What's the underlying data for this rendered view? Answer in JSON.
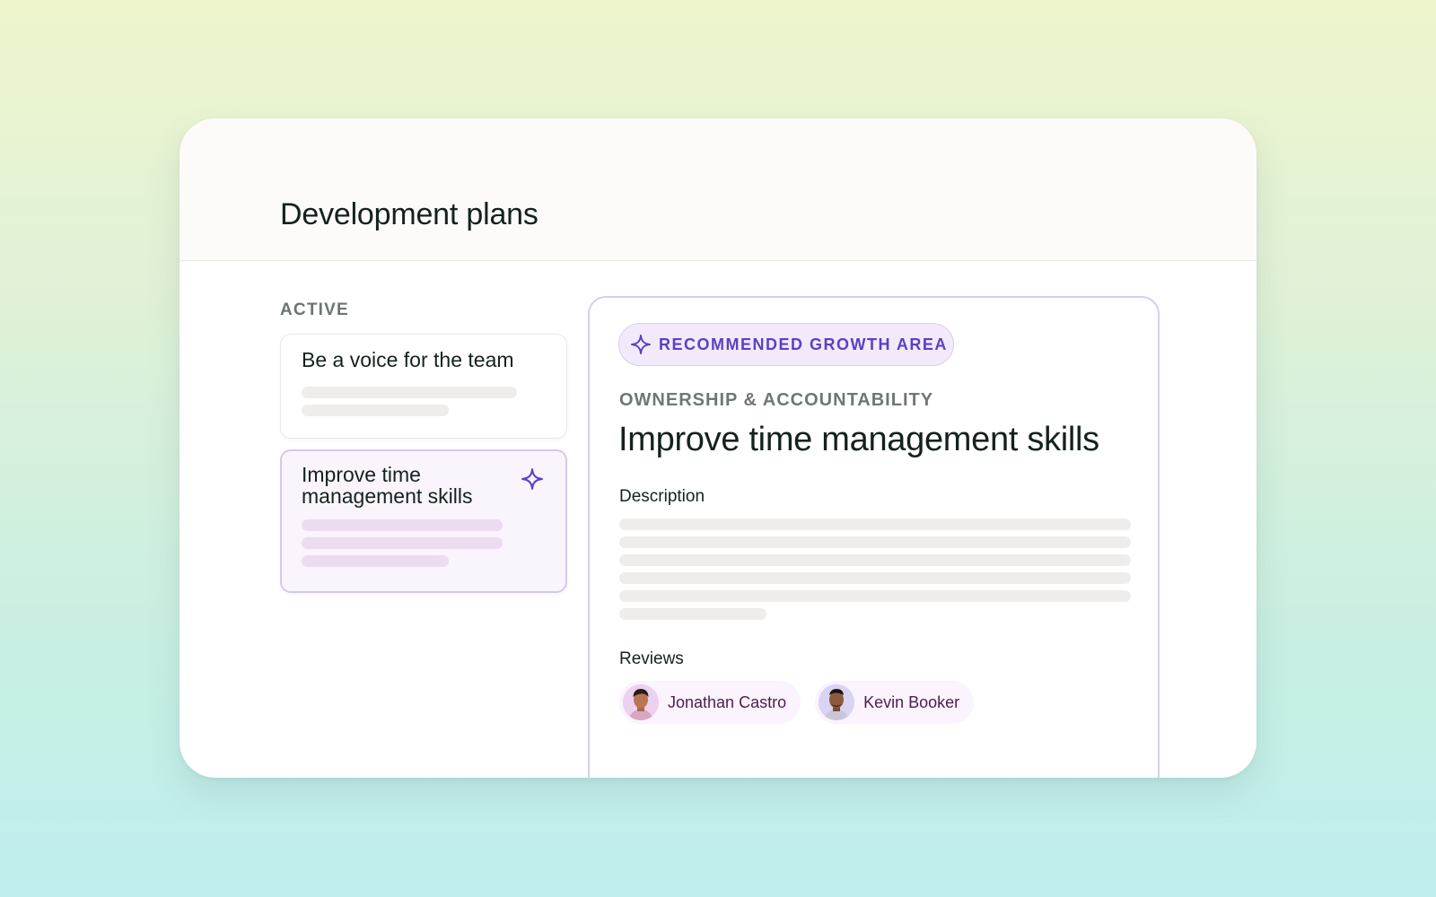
{
  "header": {
    "title": "Development plans"
  },
  "active_section": {
    "label": "ACTIVE",
    "plans": [
      {
        "title": "Be a voice for the team",
        "icon": null
      },
      {
        "title": "Improve time management skills",
        "icon": "sparkle-icon"
      }
    ]
  },
  "detail": {
    "badge": {
      "icon": "sparkle-icon",
      "label": "RECOMMENDED GROWTH AREA"
    },
    "category": "OWNERSHIP & ACCOUNTABILITY",
    "title": "Improve time management skills",
    "description_label": "Description",
    "reviews_label": "Reviews",
    "reviewers": [
      {
        "name": "Jonathan Castro",
        "avatar": "avatar-photo"
      },
      {
        "name": "Kevin Booker",
        "avatar": "avatar-photo"
      }
    ]
  },
  "colors": {
    "accent": "#5e3fc2",
    "badge_bg": "#f2eafb",
    "selected_card_bg": "#faf4fd",
    "selected_border": "#d6c7ef",
    "reviewer_chip_bg": "#fbf3fd"
  }
}
